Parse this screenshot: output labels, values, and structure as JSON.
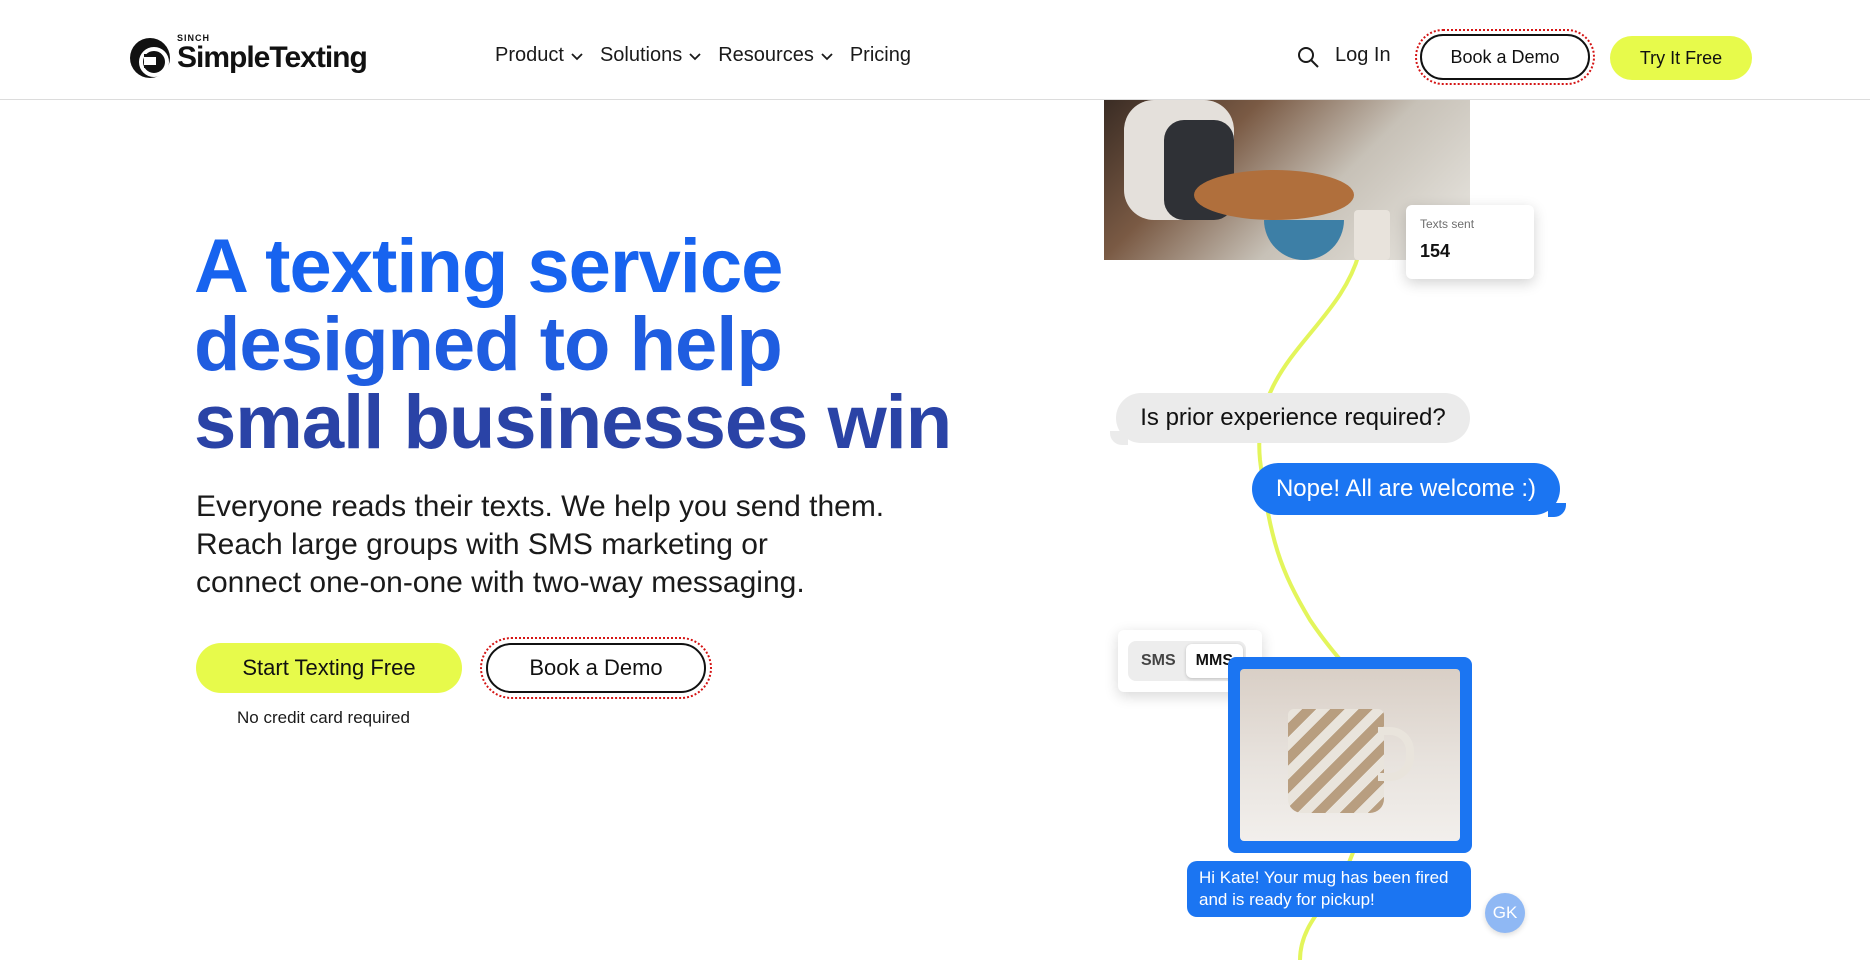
{
  "header": {
    "logo_sinch": "SINCH",
    "logo_name": "SimpleTexting",
    "nav": [
      {
        "label": "Product",
        "dropdown": true
      },
      {
        "label": "Solutions",
        "dropdown": true
      },
      {
        "label": "Resources",
        "dropdown": true
      },
      {
        "label": "Pricing",
        "dropdown": false
      }
    ],
    "login": "Log In",
    "demo": "Book a Demo",
    "try": "Try It Free"
  },
  "hero": {
    "headline": [
      "A texting service",
      "designed to help",
      "small businesses win"
    ],
    "subtext": [
      "Everyone reads their texts. We help you send them.",
      "Reach large groups with SMS marketing or",
      "connect one-on-one with two-way messaging."
    ],
    "start_button": "Start Texting Free",
    "demo_button": "Book a Demo",
    "no_cc": "No credit card required"
  },
  "illustration": {
    "texts_sent_label": "Texts sent",
    "texts_sent_value": "154",
    "question": "Is prior experience required?",
    "answer": "Nope! All are welcome :)",
    "toggle": [
      "SMS",
      "MMS"
    ],
    "toggle_active": "MMS",
    "message": [
      "Hi Kate! Your mug has been fired",
      "and is ready for pickup!"
    ],
    "avatar": "GK"
  },
  "colors": {
    "accent_yellow": "#e7fa4b",
    "brand_blue": "#1b75f2",
    "headline_blue": "#1763ef",
    "headline_navy": "#2a43a6"
  }
}
